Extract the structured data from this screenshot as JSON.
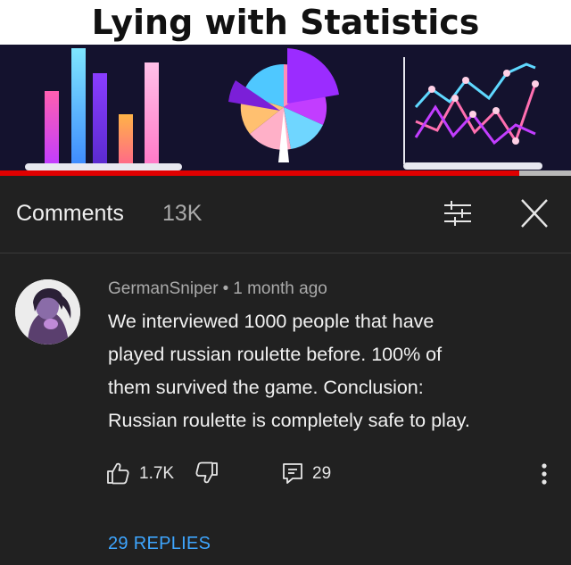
{
  "thumbnail": {
    "title": "Lying with Statistics",
    "progress_fraction": 0.91,
    "progress_color": "#e00000",
    "background_color": "#14122e"
  },
  "comments_panel": {
    "title": "Comments",
    "count": "13K",
    "icons": [
      "filter-sort-icon",
      "close-icon"
    ]
  },
  "comment": {
    "author": "GermanSniper",
    "separator": "•",
    "time": "1 month ago",
    "lines": [
      "We interviewed 1000 people that have",
      "played russian roulette before. 100% of",
      "them survived the game. Conclusion:",
      "Russian roulette is completely safe to play."
    ],
    "likes": "1.7K",
    "reply_count": "29",
    "replies_label": "29 REPLIES",
    "icons": [
      "thumbs-up-icon",
      "thumbs-down-icon",
      "reply-icon",
      "more-vertical-icon"
    ]
  },
  "colors": {
    "background": "#212121",
    "text_primary": "#f1f1f1",
    "text_secondary": "#aaaaaa",
    "link": "#3ea6ff"
  }
}
